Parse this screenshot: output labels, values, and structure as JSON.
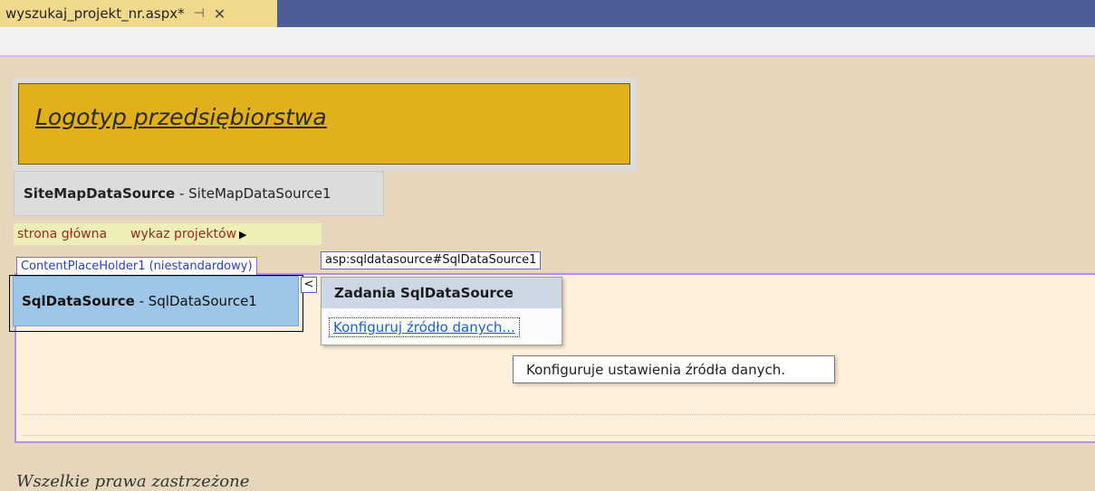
{
  "tab": {
    "filename": "wyszukaj_projekt_nr.aspx*",
    "pin_icon": "pin-icon",
    "close_icon": "close-icon"
  },
  "logo": {
    "text": "Logotyp przedsiębiorstwa"
  },
  "sitemap_control": {
    "type": "SiteMapDataSource",
    "separator": " - ",
    "id": "SiteMapDataSource1"
  },
  "menu": {
    "items": [
      "strona główna",
      "wykaz projektów"
    ],
    "arrow_icon": "triangle-right-icon"
  },
  "content_placeholder": {
    "label": "ContentPlaceHolder1 (niestandardowy)"
  },
  "selected_tag": {
    "label": "asp:sqldatasource#SqlDataSource1"
  },
  "sql_control": {
    "type": "SqlDataSource",
    "separator": " - ",
    "id": "SqlDataSource1"
  },
  "smart_tag": {
    "chevron": "<",
    "title": "Zadania SqlDataSource",
    "link": "Konfiguruj źródło danych..."
  },
  "tooltip": {
    "text": "Konfiguruje ustawienia źródła danych."
  },
  "bottom": {
    "text": "Wszelkie prawa zastrzeżone"
  }
}
